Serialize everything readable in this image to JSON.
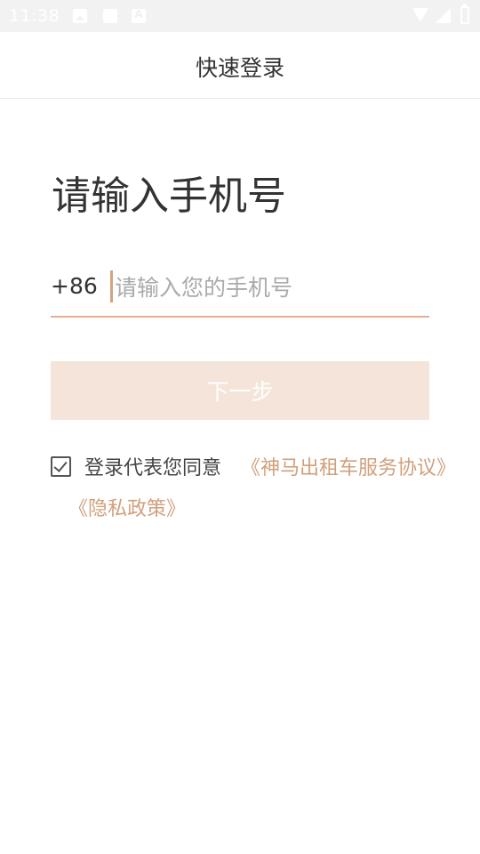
{
  "status_bar": {
    "time": "11:38",
    "icons": [
      "image-icon",
      "square-icon",
      "font-icon",
      "wifi-icon",
      "signal-icon",
      "battery-icon"
    ]
  },
  "header": {
    "title": "快速登录"
  },
  "main": {
    "heading": "请输入手机号",
    "phone": {
      "country_code": "+86",
      "value": "",
      "placeholder": "请输入您的手机号"
    },
    "next_label": "下一步",
    "agreement": {
      "checked": true,
      "text": "登录代表您同意",
      "service_link": "《神马出租车服务协议》",
      "privacy_link": "《隐私政策》"
    }
  },
  "colors": {
    "accent": "#e6b08f",
    "link": "#d0a07c",
    "button_disabled_bg": "#f4e4d9",
    "text": "#333333",
    "status_bar_bg": "#f2f2f2"
  }
}
